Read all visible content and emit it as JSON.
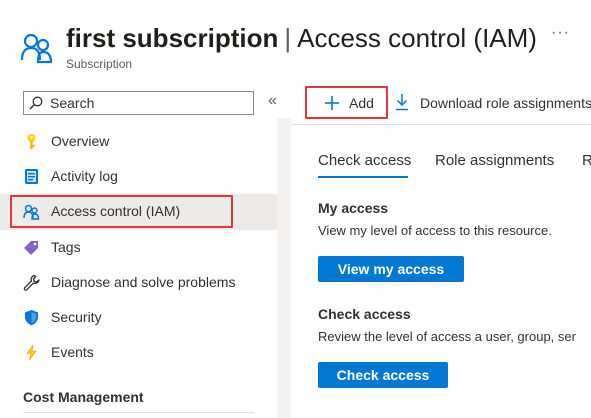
{
  "header": {
    "title_bold": "first subscription",
    "separator": "|",
    "title_rest": "Access control (IAM)",
    "subtitle": "Subscription",
    "more": "···",
    "icon": "people-icon"
  },
  "sidebar": {
    "search_placeholder": "Search",
    "collapse": "«",
    "items": [
      {
        "label": "Overview",
        "icon": "key-icon"
      },
      {
        "label": "Activity log",
        "icon": "log-icon"
      },
      {
        "label": "Access control (IAM)",
        "icon": "people-icon",
        "active": true
      },
      {
        "label": "Tags",
        "icon": "tag-icon"
      },
      {
        "label": "Diagnose and solve problems",
        "icon": "wrench-icon"
      },
      {
        "label": "Security",
        "icon": "shield-icon"
      },
      {
        "label": "Events",
        "icon": "lightning-icon"
      }
    ],
    "section_heading": "Cost Management"
  },
  "toolbar": {
    "add_label": "Add",
    "download_label": "Download role assignments"
  },
  "tabs": [
    {
      "label": "Check access",
      "active": true
    },
    {
      "label": "Role assignments"
    },
    {
      "label": "R"
    }
  ],
  "my_access": {
    "title": "My access",
    "description": "View my level of access to this resource.",
    "button": "View my access"
  },
  "check_access": {
    "title": "Check access",
    "description": "Review the level of access a user, group, ser",
    "button": "Check access"
  },
  "colors": {
    "accent": "#0078d4",
    "highlight": "#e0373f",
    "active_bg": "#edebe9"
  }
}
